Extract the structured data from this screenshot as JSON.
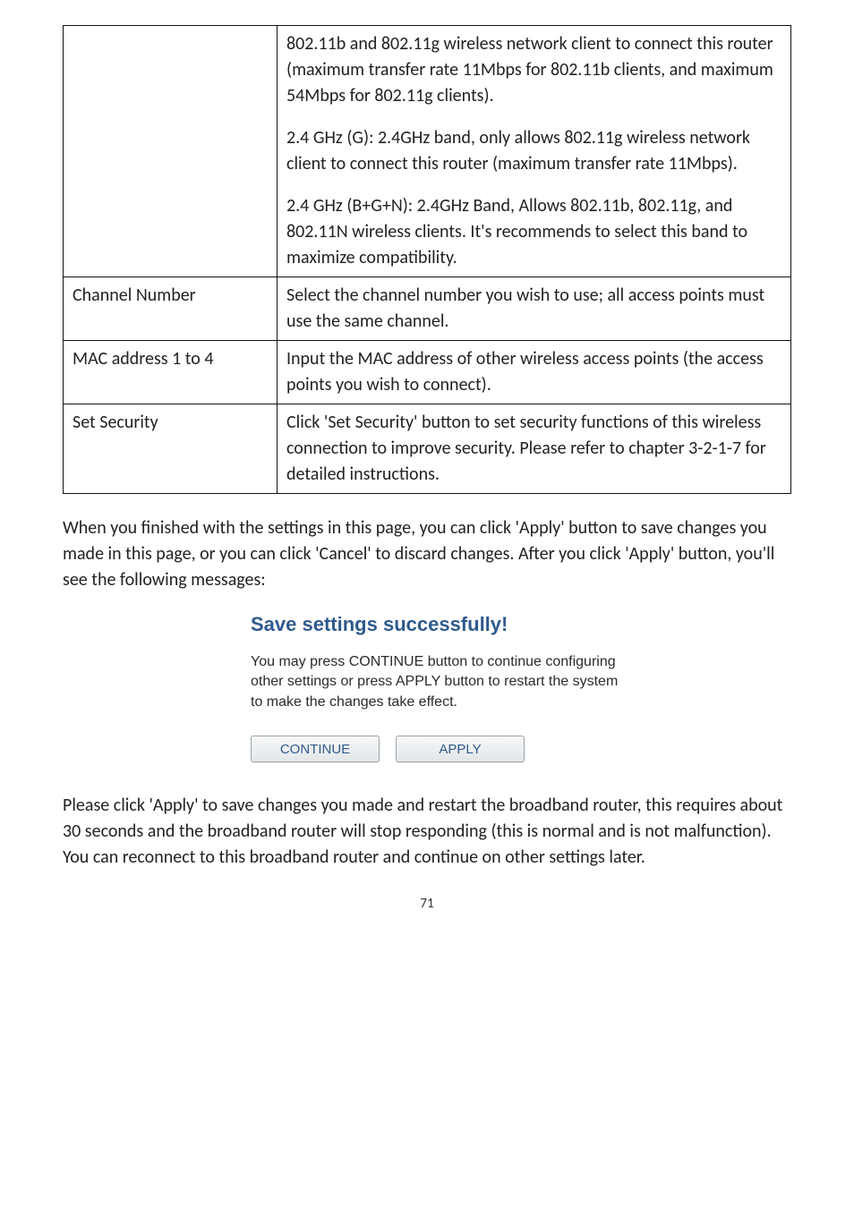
{
  "table": {
    "row1": {
      "label": "",
      "p1": "802.11b and 802.11g wireless network client to connect this router (maximum transfer rate 11Mbps for 802.11b clients, and maximum 54Mbps for 802.11g clients).",
      "p2": "2.4 GHz (G): 2.4GHz band, only allows 802.11g wireless network client to connect this router (maximum transfer rate 11Mbps).",
      "p3": "2.4 GHz (B+G+N): 2.4GHz Band, Allows 802.11b, 802.11g, and 802.11N wireless clients. It's recommends to select this band to maximize compatibility."
    },
    "row2": {
      "label": "Channel Number",
      "val": "Select the channel number you wish to use; all access points must use the same channel."
    },
    "row3": {
      "label": "MAC address 1 to 4",
      "val": "Input the MAC address of other wireless access points (the access points you wish to connect)."
    },
    "row4": {
      "label": "Set Security",
      "val": "Click 'Set Security' button to set security functions of this wireless connection to improve security. Please refer to chapter 3-2-1-7 for detailed instructions."
    }
  },
  "para1": "When you finished with the settings in this page, you can click 'Apply' button to save changes you made in this page, or you can click 'Cancel' to discard changes. After you click 'Apply' button, you'll see the following messages:",
  "success": {
    "title": "Save settings successfully!",
    "msg": "You may press CONTINUE button to continue configuring other settings or press APPLY button to restart the system to make the changes take effect.",
    "continue_label": "CONTINUE",
    "apply_label": "APPLY"
  },
  "para2": "Please click 'Apply' to save changes you made and restart the broadband router, this requires about 30 seconds and the broadband router will stop responding (this is normal and is not malfunction). You can reconnect to this broadband router and continue on other settings later.",
  "page_number": "71"
}
